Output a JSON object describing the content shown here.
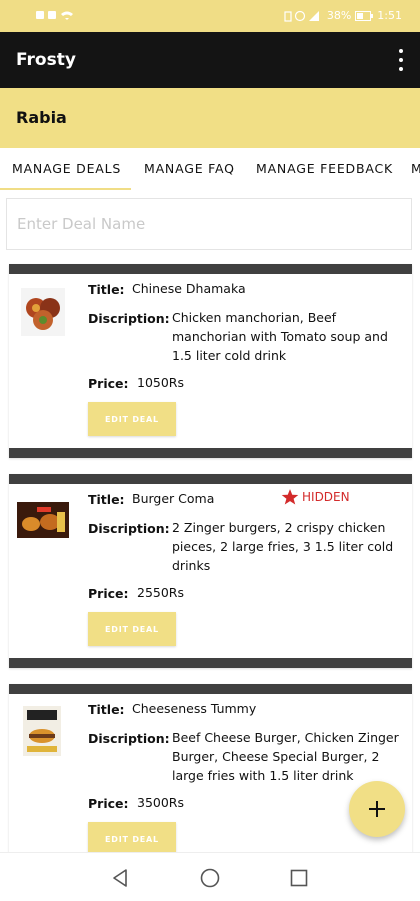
{
  "status_bar": {
    "left_icons": [
      "notification-icon",
      "notification-icon",
      "wifi-icon"
    ],
    "right_icons": [
      "vibrate-icon",
      "alarm-icon",
      "signal-icon"
    ],
    "battery": "38%",
    "time": "1:51"
  },
  "app_bar": {
    "title": "Frosty",
    "menu_icon": "more-vert-icon"
  },
  "user_bar": {
    "name": "Rabia"
  },
  "tabs": [
    {
      "label": "MANAGE DEALS",
      "active": true
    },
    {
      "label": "MANAGE FAQ",
      "active": false
    },
    {
      "label": "MANAGE FEEDBACK",
      "active": false
    },
    {
      "label": "M",
      "active": false
    }
  ],
  "search": {
    "placeholder": "Enter Deal Name"
  },
  "labels": {
    "title": "Title:",
    "description": "Discription:",
    "price": "Price:",
    "edit": "EDIT DEAL"
  },
  "deals": [
    {
      "title": "Chinese Dhamaka",
      "description": "Chicken manchorian, Beef manchorian with Tomato soup and 1.5 liter cold drink",
      "price": "1050Rs",
      "hidden": false
    },
    {
      "title": "Burger Coma",
      "description": "2 Zinger burgers, 2 crispy chicken pieces, 2 large fries, 3 1.5 liter cold drinks",
      "price": "2550Rs",
      "hidden": true,
      "hidden_label": "HIDDEN"
    },
    {
      "title": "Cheeseness Tummy",
      "description": "Beef Cheese Burger, Chicken Zinger Burger, Cheese Special Burger, 2 large fries with 1.5 liter drink",
      "price": "3500Rs",
      "hidden": false
    }
  ],
  "fab": {
    "label": "+"
  },
  "colors": {
    "accent": "#f1df86",
    "dark": "#141414",
    "hidden": "#d32b2b",
    "card_bar": "#404040"
  }
}
